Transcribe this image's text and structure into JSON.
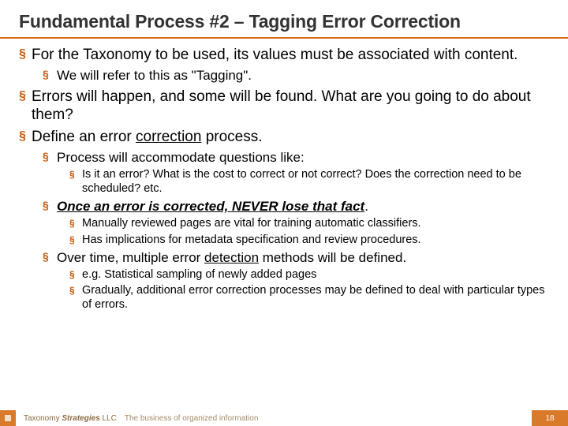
{
  "title": "Fundamental Process #2 – Tagging Error Correction",
  "bullets": {
    "b1a": "For the Taxonomy to be used, its values must be associated with content.",
    "b1_1": "We will refer to this as \"Tagging\".",
    "b2": "Errors will happen, and some will be found. What are you going to do about them?",
    "b3_pre": "Define an error ",
    "b3_u": "correction",
    "b3_post": " process.",
    "b3_1": "Process will accommodate questions like:",
    "b3_1_1": "Is it an error? What is the cost to correct or not correct? Does the correction need to be scheduled? etc.",
    "b3_2_u": "Once an error is corrected, NEVER lose that fact",
    "b3_2_post": ".",
    "b3_2_1": "Manually reviewed pages are vital for training automatic classifiers.",
    "b3_2_2": "Has implications for metadata specification and review procedures.",
    "b3_3_pre": "Over time, multiple error ",
    "b3_3_u": "detection",
    "b3_3_post": " methods will be defined.",
    "b3_3_1": "e.g. Statistical sampling of newly added pages",
    "b3_3_2": "Gradually, additional error correction processes may be defined to deal with particular types of errors."
  },
  "footer": {
    "brand_pre": "Taxonomy ",
    "brand_italic": "Strategies",
    "brand_post": " LLC",
    "tagline": "The business of organized information",
    "page": "18"
  }
}
